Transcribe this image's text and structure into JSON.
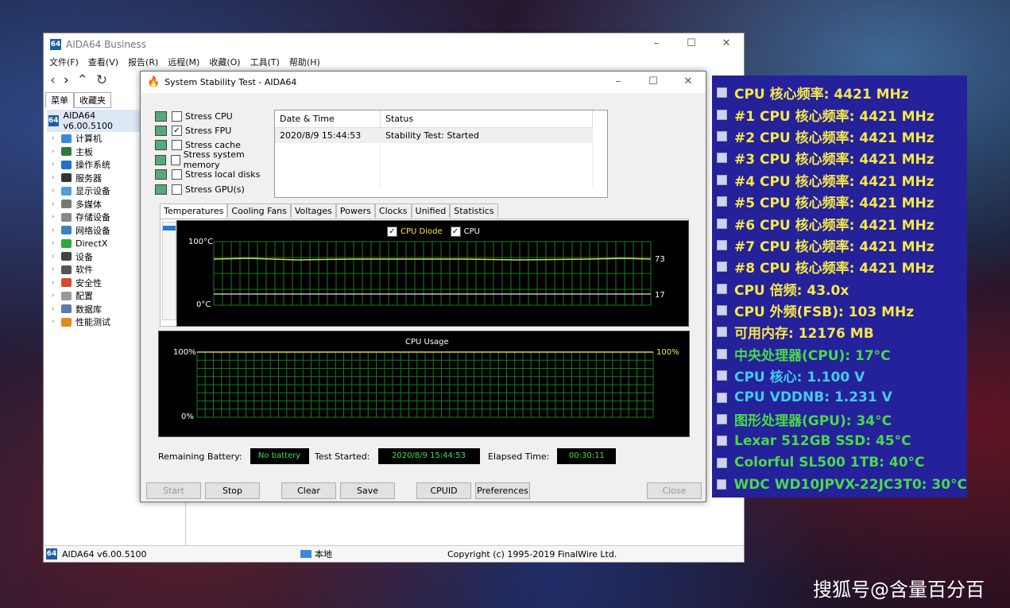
{
  "main_window": {
    "title": "AIDA64 Business",
    "logo": "64",
    "menu": [
      "文件(F)",
      "查看(V)",
      "报告(R)",
      "远程(M)",
      "收藏(O)",
      "工具(T)",
      "帮助(H)"
    ],
    "left_tabs": [
      "菜单",
      "收藏夹"
    ],
    "tree_root": "AIDA64 v6.00.5100",
    "tree_items": [
      {
        "label": "计算机",
        "color": "#3a8ad8"
      },
      {
        "label": "主板",
        "color": "#2e7a3a"
      },
      {
        "label": "操作系统",
        "color": "#1f6fd1"
      },
      {
        "label": "服务器",
        "color": "#333333"
      },
      {
        "label": "显示设备",
        "color": "#4aa0e0"
      },
      {
        "label": "多媒体",
        "color": "#777777"
      },
      {
        "label": "存储设备",
        "color": "#888888"
      },
      {
        "label": "网络设备",
        "color": "#3f7fbf"
      },
      {
        "label": "DirectX",
        "color": "#2fa83a"
      },
      {
        "label": "设备",
        "color": "#444444"
      },
      {
        "label": "软件",
        "color": "#555555"
      },
      {
        "label": "安全性",
        "color": "#d84a2a"
      },
      {
        "label": "配置",
        "color": "#999999"
      },
      {
        "label": "数据库",
        "color": "#5a7ab0"
      },
      {
        "label": "性能测试",
        "color": "#e08a20"
      }
    ],
    "status_left": "AIDA64 v6.00.5100",
    "status_mid": "本地",
    "status_right": "Copyright (c) 1995-2019 FinalWire Ltd."
  },
  "stability": {
    "title": "System Stability Test - AIDA64",
    "stress_options": [
      {
        "label": "Stress CPU",
        "checked": false,
        "icon": "cpu-icon"
      },
      {
        "label": "Stress FPU",
        "checked": true,
        "icon": "fpu-icon"
      },
      {
        "label": "Stress cache",
        "checked": false,
        "icon": "cache-icon"
      },
      {
        "label": "Stress system memory",
        "checked": false,
        "icon": "memory-icon"
      },
      {
        "label": "Stress local disks",
        "checked": false,
        "icon": "disk-icon"
      },
      {
        "label": "Stress GPU(s)",
        "checked": false,
        "icon": "gpu-icon"
      }
    ],
    "log_headers": [
      "Date & Time",
      "Status"
    ],
    "log_rows": [
      [
        "2020/8/9 15:44:53",
        "Stability Test: Started"
      ]
    ],
    "graph_tabs": [
      "Temperatures",
      "Cooling Fans",
      "Voltages",
      "Powers",
      "Clocks",
      "Unified",
      "Statistics"
    ],
    "temp_legend": [
      "CPU Diode",
      "CPU"
    ],
    "temp_top_label": "100°C",
    "temp_bottom_label": "0°C",
    "temp_value_high": "73",
    "temp_value_low": "17",
    "usage_title": "CPU Usage",
    "usage_top_label": "100%",
    "usage_bottom_label": "0%",
    "usage_value": "100%",
    "battery_label": "Remaining Battery:",
    "battery_value": "No battery",
    "started_label": "Test Started:",
    "started_value": "2020/8/9 15:44:53",
    "elapsed_label": "Elapsed Time:",
    "elapsed_value": "00:30:11",
    "buttons": {
      "start": "Start",
      "stop": "Stop",
      "clear": "Clear",
      "save": "Save",
      "cpuid": "CPUID",
      "preferences": "Preferences",
      "close": "Close"
    }
  },
  "osd": [
    {
      "text": "CPU 核心频率: 4421 MHz",
      "color": "#f5e84a"
    },
    {
      "text": "#1 CPU 核心频率: 4421 MHz",
      "color": "#f5e84a"
    },
    {
      "text": "#2 CPU 核心频率: 4421 MHz",
      "color": "#f5e84a"
    },
    {
      "text": "#3 CPU 核心频率: 4421 MHz",
      "color": "#f5e84a"
    },
    {
      "text": "#4 CPU 核心频率: 4421 MHz",
      "color": "#f5e84a"
    },
    {
      "text": "#5 CPU 核心频率: 4421 MHz",
      "color": "#f5e84a"
    },
    {
      "text": "#6 CPU 核心频率: 4421 MHz",
      "color": "#f5e84a"
    },
    {
      "text": "#7 CPU 核心频率: 4421 MHz",
      "color": "#f5e84a"
    },
    {
      "text": "#8 CPU 核心频率: 4421 MHz",
      "color": "#f5e84a"
    },
    {
      "text": "CPU 倍频: 43.0x",
      "color": "#f5e84a"
    },
    {
      "text": "CPU 外频(FSB): 103 MHz",
      "color": "#f5e84a"
    },
    {
      "text": "可用内存: 12176 MB",
      "color": "#f5e84a"
    },
    {
      "text": "中央处理器(CPU): 17°C",
      "color": "#49d94a"
    },
    {
      "text": "CPU 核心: 1.100 V",
      "color": "#46c9ec"
    },
    {
      "text": "CPU VDDNB: 1.231 V",
      "color": "#46c9ec"
    },
    {
      "text": "图形处理器(GPU): 34°C",
      "color": "#49d94a"
    },
    {
      "text": "Lexar 512GB SSD: 45°C",
      "color": "#49d94a"
    },
    {
      "text": "Colorful SL500 1TB: 40°C",
      "color": "#49d94a"
    },
    {
      "text": "WDC WD10JPVX-22JC3T0: 30°C",
      "color": "#49d94a"
    }
  ],
  "watermark": "搜狐号@含量百分百"
}
